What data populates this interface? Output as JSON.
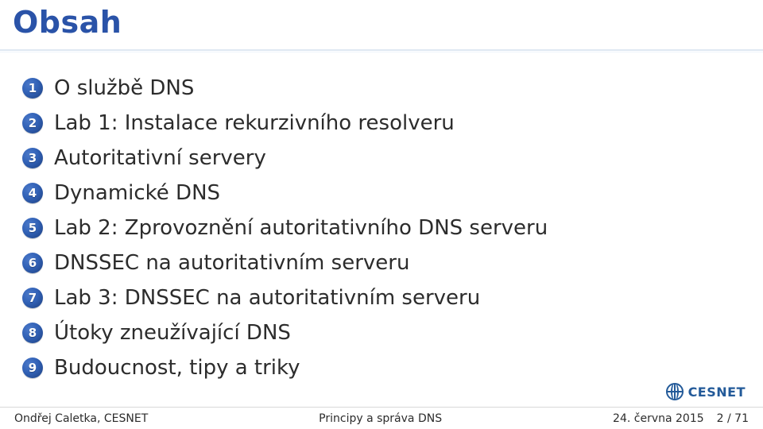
{
  "title": "Obsah",
  "items": [
    {
      "num": "1",
      "label": "O službě DNS"
    },
    {
      "num": "2",
      "label": "Lab 1: Instalace rekurzivního resolveru"
    },
    {
      "num": "3",
      "label": "Autoritativní servery"
    },
    {
      "num": "4",
      "label": "Dynamické DNS"
    },
    {
      "num": "5",
      "label": "Lab 2: Zprovoznění autoritativního DNS serveru"
    },
    {
      "num": "6",
      "label": "DNSSEC na autoritativním serveru"
    },
    {
      "num": "7",
      "label": "Lab 3: DNSSEC na autoritativním serveru"
    },
    {
      "num": "8",
      "label": "Útoky zneužívající DNS"
    },
    {
      "num": "9",
      "label": "Budoucnost, tipy a triky"
    }
  ],
  "logo": {
    "brand": "CESNET"
  },
  "footer": {
    "left": "Ondřej Caletka, CESNET",
    "center": "Principy a správa DNS",
    "date": "24. června 2015",
    "page": "2 / 71"
  }
}
